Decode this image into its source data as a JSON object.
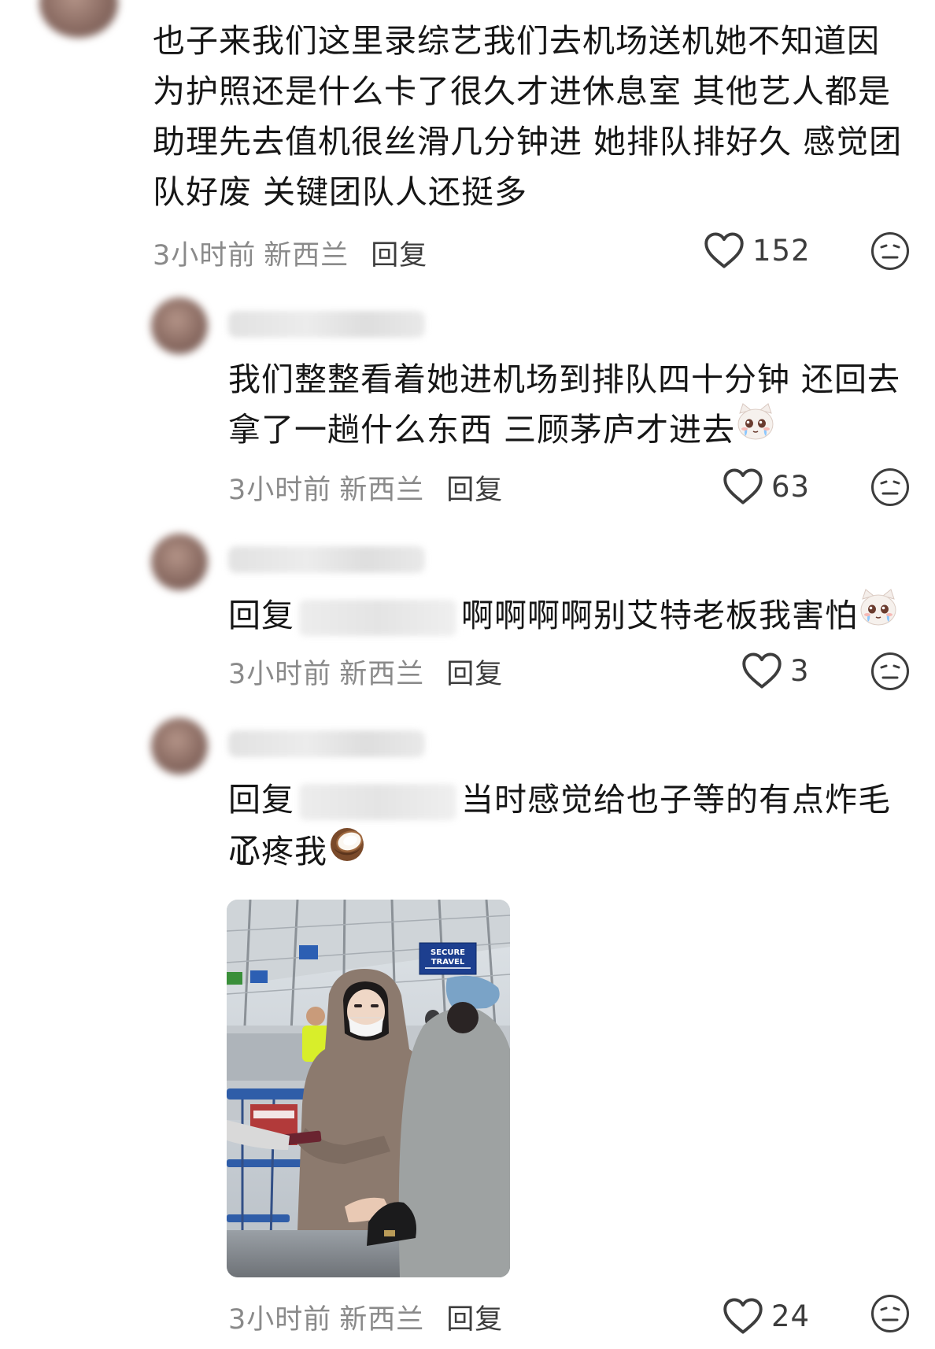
{
  "comments": [
    {
      "text": "也子来我们这里录综艺我们去机场送机她不知道因为护照还是什么卡了很久才进休息室 其他艺人都是助理先去值机很丝滑几分钟进 她排队排好久 感觉团队好废 关键团队人还挺多",
      "time": "3小时前",
      "location": "新西兰",
      "reply_label": "回复",
      "likes": "152"
    },
    {
      "text": "我们整整看着她进机场到排队四十分钟 还回去拿了一趟什么东西 三顾茅庐才进去",
      "emoji": "crying-cat-emoji",
      "time": "3小时前",
      "location": "新西兰",
      "reply_label": "回复",
      "likes": "63"
    },
    {
      "reply_prefix": "回复",
      "text": "啊啊啊啊别艾特老板我害怕",
      "emoji": "crying-cat-emoji",
      "time": "3小时前",
      "location": "新西兰",
      "reply_label": "回复",
      "likes": "3"
    },
    {
      "reply_prefix": "回复",
      "text": "当时感觉给也子等的有点炸毛了",
      "text_line2": "心疼我",
      "emoji": "coconut-emoji",
      "image": "airport-photo",
      "time": "3小时前",
      "location": "新西兰",
      "reply_label": "回复",
      "likes": "24"
    }
  ],
  "photo_sign": {
    "line1": "SECURE",
    "line2": "TRAVEL"
  },
  "colors": {
    "text": "#161616",
    "meta": "#8a8a8a",
    "icon": "#3d3d3d"
  }
}
